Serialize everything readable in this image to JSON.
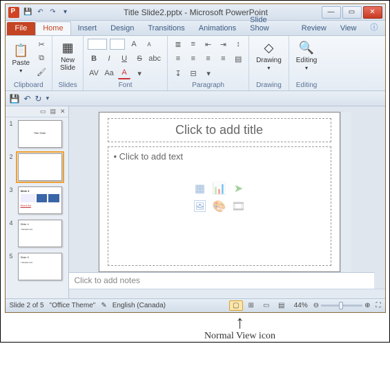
{
  "window": {
    "title": "Title Slide2.pptx - Microsoft PowerPoint"
  },
  "tabs": {
    "file": "File",
    "home": "Home",
    "insert": "Insert",
    "design": "Design",
    "transitions": "Transitions",
    "animations": "Animations",
    "slideshow": "Slide Show",
    "review": "Review",
    "view": "View"
  },
  "ribbon": {
    "clipboard": {
      "label": "Clipboard",
      "paste": "Paste"
    },
    "slides": {
      "label": "Slides",
      "newslide": "New\nSlide"
    },
    "font": {
      "label": "Font"
    },
    "paragraph": {
      "label": "Paragraph"
    },
    "drawing": {
      "label": "Drawing",
      "btn": "Drawing"
    },
    "editing": {
      "label": "Editing",
      "btn": "Editing"
    }
  },
  "thumbs": [
    {
      "n": "1",
      "title": "Title Slide"
    },
    {
      "n": "2",
      "title": ""
    },
    {
      "n": "3",
      "title": "Slide 3"
    },
    {
      "n": "4",
      "title": "Slide 4"
    },
    {
      "n": "5",
      "title": "Slide 5"
    }
  ],
  "slide": {
    "title_ph": "Click to add title",
    "body_ph": "Click to add text"
  },
  "notes": {
    "ph": "Click to add notes"
  },
  "status": {
    "slide": "Slide 2 of 5",
    "theme": "\"Office Theme\"",
    "lang": "English (Canada)",
    "zoom": "44%"
  },
  "callout": {
    "label": "Normal View icon"
  }
}
